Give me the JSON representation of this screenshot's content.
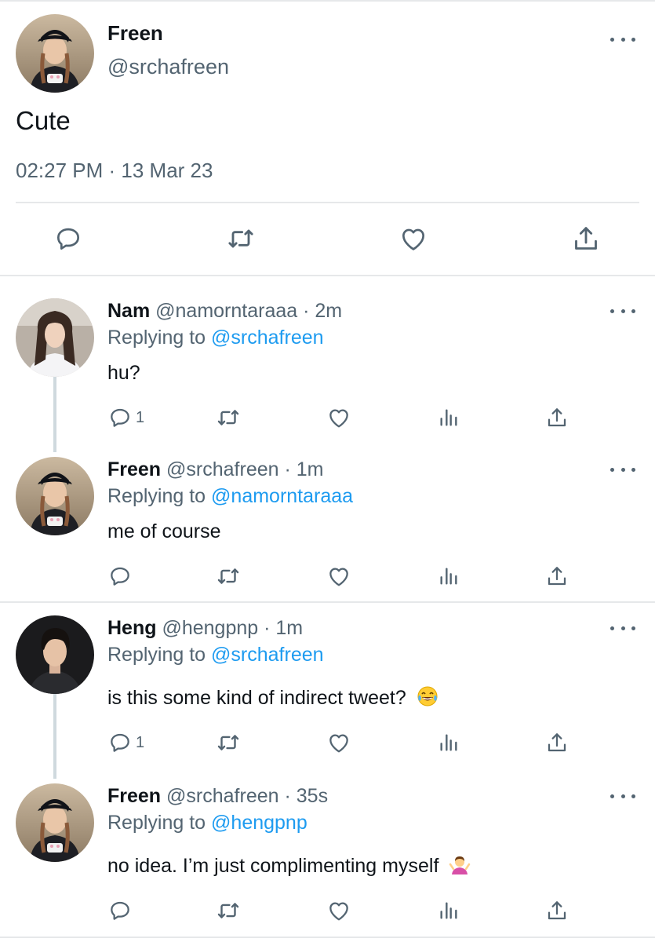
{
  "main_tweet": {
    "author_name": "Freen",
    "author_handle": "@srchafreen",
    "text": "Cute",
    "timestamp": "02:27 PM · 13 Mar 23",
    "avatar_icon": "avatar-freen"
  },
  "replies": [
    {
      "name": "Nam",
      "handle_time": "@namorntaraaa · 2m",
      "replying_label": "Replying to",
      "replying_to": "@srchafreen",
      "text": "hu?",
      "reply_count": "1"
    },
    {
      "name": "Freen",
      "handle_time": "@srchafreen · 1m",
      "replying_label": "Replying to",
      "replying_to": "@namorntaraaa",
      "text": "me of course",
      "reply_count": ""
    },
    {
      "name": "Heng",
      "handle_time": "@hengpnp · 1m",
      "replying_label": "Replying to",
      "replying_to": "@srchafreen",
      "text": "is this some kind of indirect tweet?",
      "emoji": "face-with-tears-of-joy",
      "reply_count": "1"
    },
    {
      "name": "Freen",
      "handle_time": "@srchafreen · 35s",
      "replying_label": "Replying to",
      "replying_to": "@hengpnp",
      "text": "no idea. I’m just complimenting myself",
      "emoji": "person-shrugging",
      "reply_count": ""
    }
  ],
  "colors": {
    "text": "#0f1419",
    "secondary": "#536471",
    "link": "#1d9bf0",
    "divider": "#e6e8ea",
    "thread": "#cfd9de"
  }
}
